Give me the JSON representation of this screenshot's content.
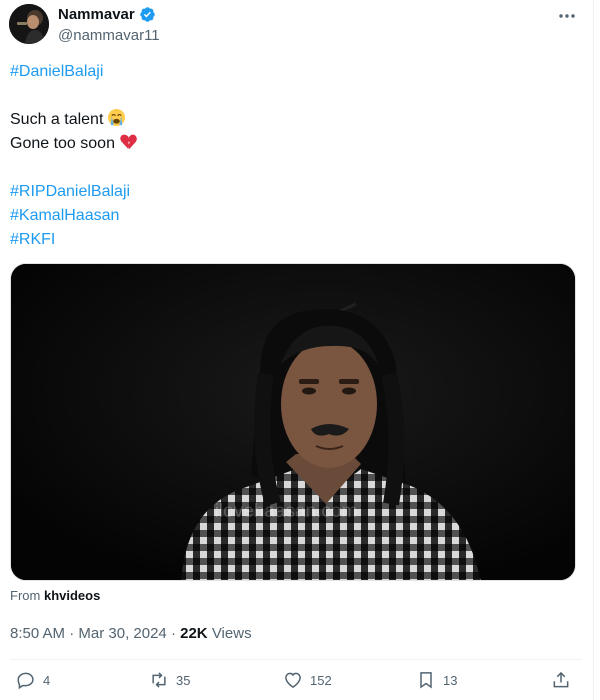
{
  "author": {
    "display_name": "Nammavar",
    "handle": "@nammavar11",
    "verified": true,
    "avatar_icon": "kamal-haasan-avatar"
  },
  "tweet": {
    "lines": [
      {
        "text": "#DanielBalaji",
        "kind": "hashtag"
      },
      {
        "text": "",
        "kind": "gap"
      },
      {
        "text": "Such a talent",
        "kind": "text",
        "emoji": "crying-face-emoji"
      },
      {
        "text": "Gone too soon",
        "kind": "text",
        "emoji": "broken-heart-emoji"
      },
      {
        "text": "",
        "kind": "gap"
      },
      {
        "text": "#RIPDanielBalaji",
        "kind": "hashtag"
      },
      {
        "text": "#KamalHaasan",
        "kind": "hashtag"
      },
      {
        "text": "#RKFI",
        "kind": "hashtag"
      }
    ]
  },
  "media": {
    "watermark": "ilovehaasan.com",
    "description_icon": "video-still-man-checked-shirt"
  },
  "source": {
    "label": "From",
    "name": "khvideos"
  },
  "meta": {
    "time": "8:50 AM",
    "separator": "·",
    "date": "Mar 30, 2024",
    "views_count": "22K",
    "views_label": "Views"
  },
  "actions": {
    "replies": "4",
    "reposts": "35",
    "likes": "152",
    "bookmarks": "13"
  },
  "colors": {
    "link": "#1d9bf0",
    "secondary_text": "#536471",
    "primary_text": "#0f1419",
    "verified": "#1d9bf0"
  }
}
